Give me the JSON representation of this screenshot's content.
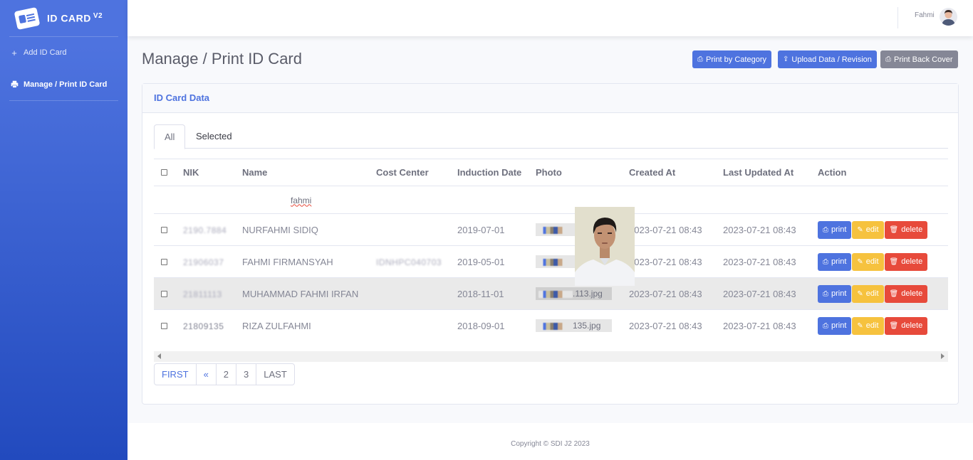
{
  "brand": {
    "title": "ID CARD",
    "version": "V2"
  },
  "sidebar": {
    "items": [
      {
        "label": "Add ID Card",
        "icon": "plus-icon"
      },
      {
        "label": "Manage / Print ID Card",
        "icon": "print-icon"
      }
    ]
  },
  "topbar": {
    "user_name": "Fahmi"
  },
  "page": {
    "title": "Manage / Print ID Card"
  },
  "toolbar": {
    "print_by_category": "Print by Category",
    "upload_data": "Upload Data / Revision",
    "print_back_cover": "Print Back Cover"
  },
  "card": {
    "title": "ID Card Data"
  },
  "tabs": [
    "All",
    "Selected"
  ],
  "table": {
    "columns": [
      "NIK",
      "Name",
      "Cost Center",
      "Induction Date",
      "Photo",
      "Created At",
      "Last Updated At",
      "Action"
    ],
    "filter_name": "fahmi",
    "rows": [
      {
        "nik": "2190.7884",
        "name": "NURFAHMI SIDIQ",
        "cost_center": "",
        "induction_date": "2019-07-01",
        "photo": "",
        "created_at": "2023-07-21 08:43",
        "updated_at": "2023-07-21 08:43"
      },
      {
        "nik": "21906037",
        "name": "FAHMI FIRMANSYAH",
        "cost_center": "IDNHPC040703",
        "induction_date": "2019-05-01",
        "photo": "",
        "created_at": "2023-07-21 08:43",
        "updated_at": "2023-07-21 08:43"
      },
      {
        "nik": "21811113",
        "name": "MUHAMMAD FAHMI IRFAN",
        "cost_center": "",
        "induction_date": "2018-11-01",
        "photo": ".113.jpg",
        "created_at": "2023-07-21 08:43",
        "updated_at": "2023-07-21 08:43"
      },
      {
        "nik": "21809135",
        "name": "RIZA ZULFAHMI",
        "cost_center": "",
        "induction_date": "2018-09-01",
        "photo": "135.jpg",
        "created_at": "2023-07-21 08:43",
        "updated_at": "2023-07-21 08:43"
      }
    ],
    "actions": {
      "print": "print",
      "edit": "edit",
      "delete": "delete"
    }
  },
  "pagination": [
    "FIRST",
    "«",
    "2",
    "3",
    "LAST"
  ],
  "footer": {
    "copyright": "Copyright © SDI J2 2023"
  },
  "colors": {
    "primary": "#4e73df",
    "warning": "#f6c23e",
    "danger": "#e74a3b",
    "secondary": "#858796"
  }
}
